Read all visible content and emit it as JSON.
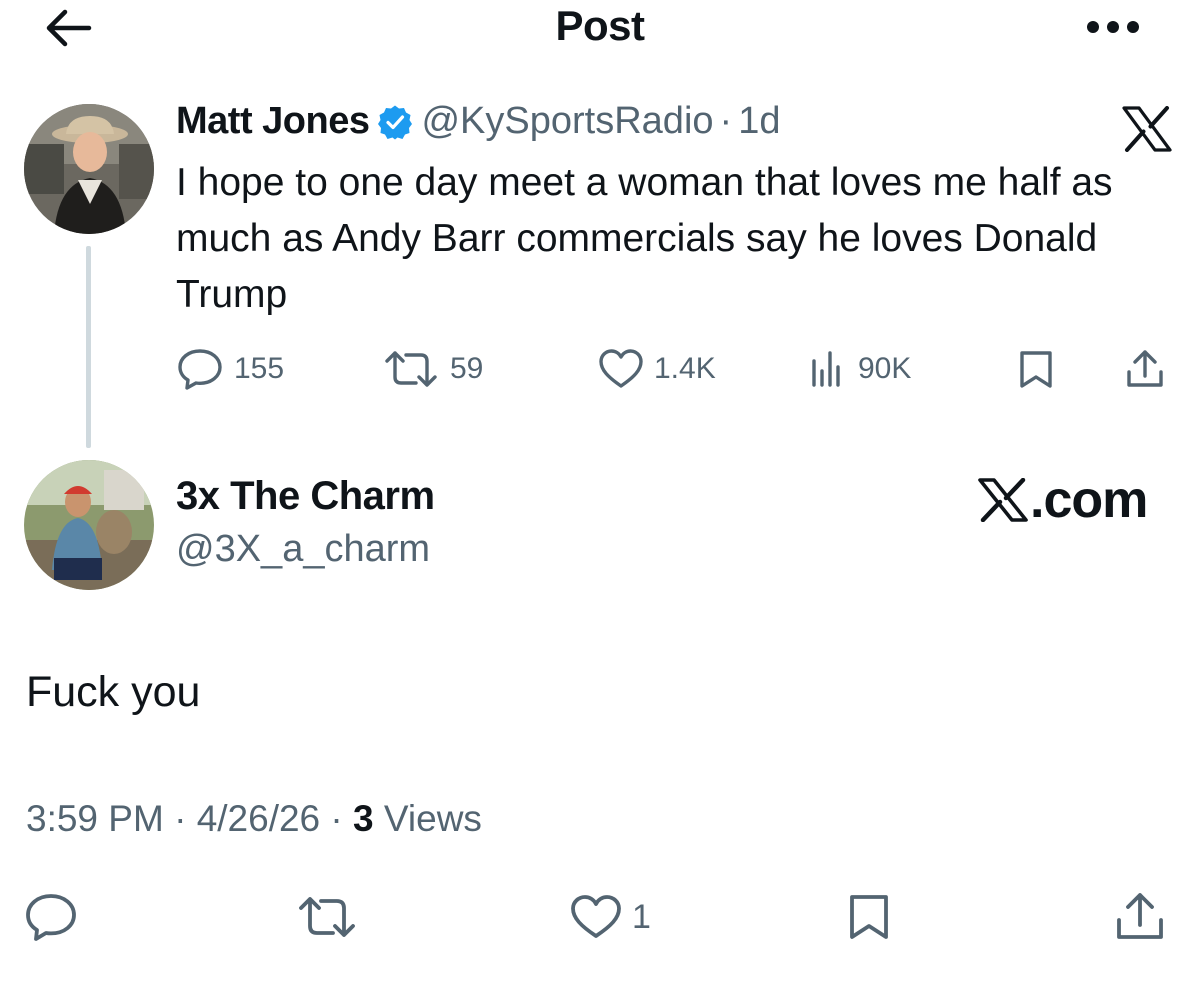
{
  "header": {
    "title": "Post"
  },
  "original_post": {
    "author_name": "Matt Jones",
    "handle": "@KySportsRadio",
    "separator": "·",
    "time": "1d",
    "text": "I hope to one day meet a woman that loves me half as much as Andy Barr commercials say he loves Donald Trump",
    "actions": {
      "replies": "155",
      "reposts": "59",
      "likes": "1.4K",
      "views": "90K"
    }
  },
  "reply": {
    "author_name": "3x The Charm",
    "handle": "@3X_a_charm",
    "brand": ".com",
    "text": "Fuck you",
    "meta": {
      "time": "3:59 PM",
      "sep1": " · ",
      "date": "4/26/26",
      "sep2": " · ",
      "views_count": "3",
      "views_label": " Views"
    },
    "actions": {
      "likes": "1"
    }
  },
  "colors": {
    "text": "#0f1419",
    "secondary": "#536471",
    "verified": "#1d9bf0",
    "thread_line": "#cfd9de"
  }
}
